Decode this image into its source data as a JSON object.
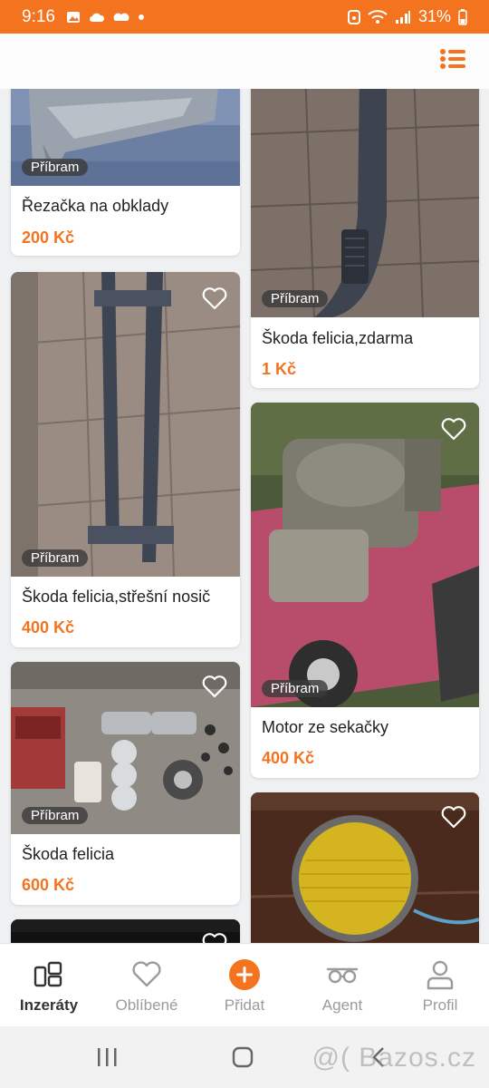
{
  "status_bar": {
    "time": "9:16",
    "battery": "31%"
  },
  "listings": [
    {
      "location": "Příbram",
      "title": "Řezačka na obklady",
      "price": "200 Kč"
    },
    {
      "location": "Příbram",
      "title": "Škoda felicia,zdarma",
      "price": "1 Kč"
    },
    {
      "location": "Příbram",
      "title": "Škoda felicia,střešní nosič",
      "price": "400 Kč"
    },
    {
      "location": "Příbram",
      "title": "Motor ze sekačky",
      "price": "400 Kč"
    },
    {
      "location": "Příbram",
      "title": "Škoda felicia",
      "price": "600 Kč"
    }
  ],
  "bottom_nav": [
    {
      "label": "Inzeráty",
      "icon": "listings-icon",
      "active": true
    },
    {
      "label": "Oblíbené",
      "icon": "heart-icon",
      "active": false
    },
    {
      "label": "Přidat",
      "icon": "add-icon",
      "active": false
    },
    {
      "label": "Agent",
      "icon": "agent-glasses-icon",
      "active": false
    },
    {
      "label": "Profil",
      "icon": "profile-icon",
      "active": false
    }
  ],
  "watermark": "@( Bazos.cz",
  "colors": {
    "accent": "#f4731f",
    "background": "#eef0f2",
    "text": "#222222",
    "muted": "#9b9b9b"
  }
}
